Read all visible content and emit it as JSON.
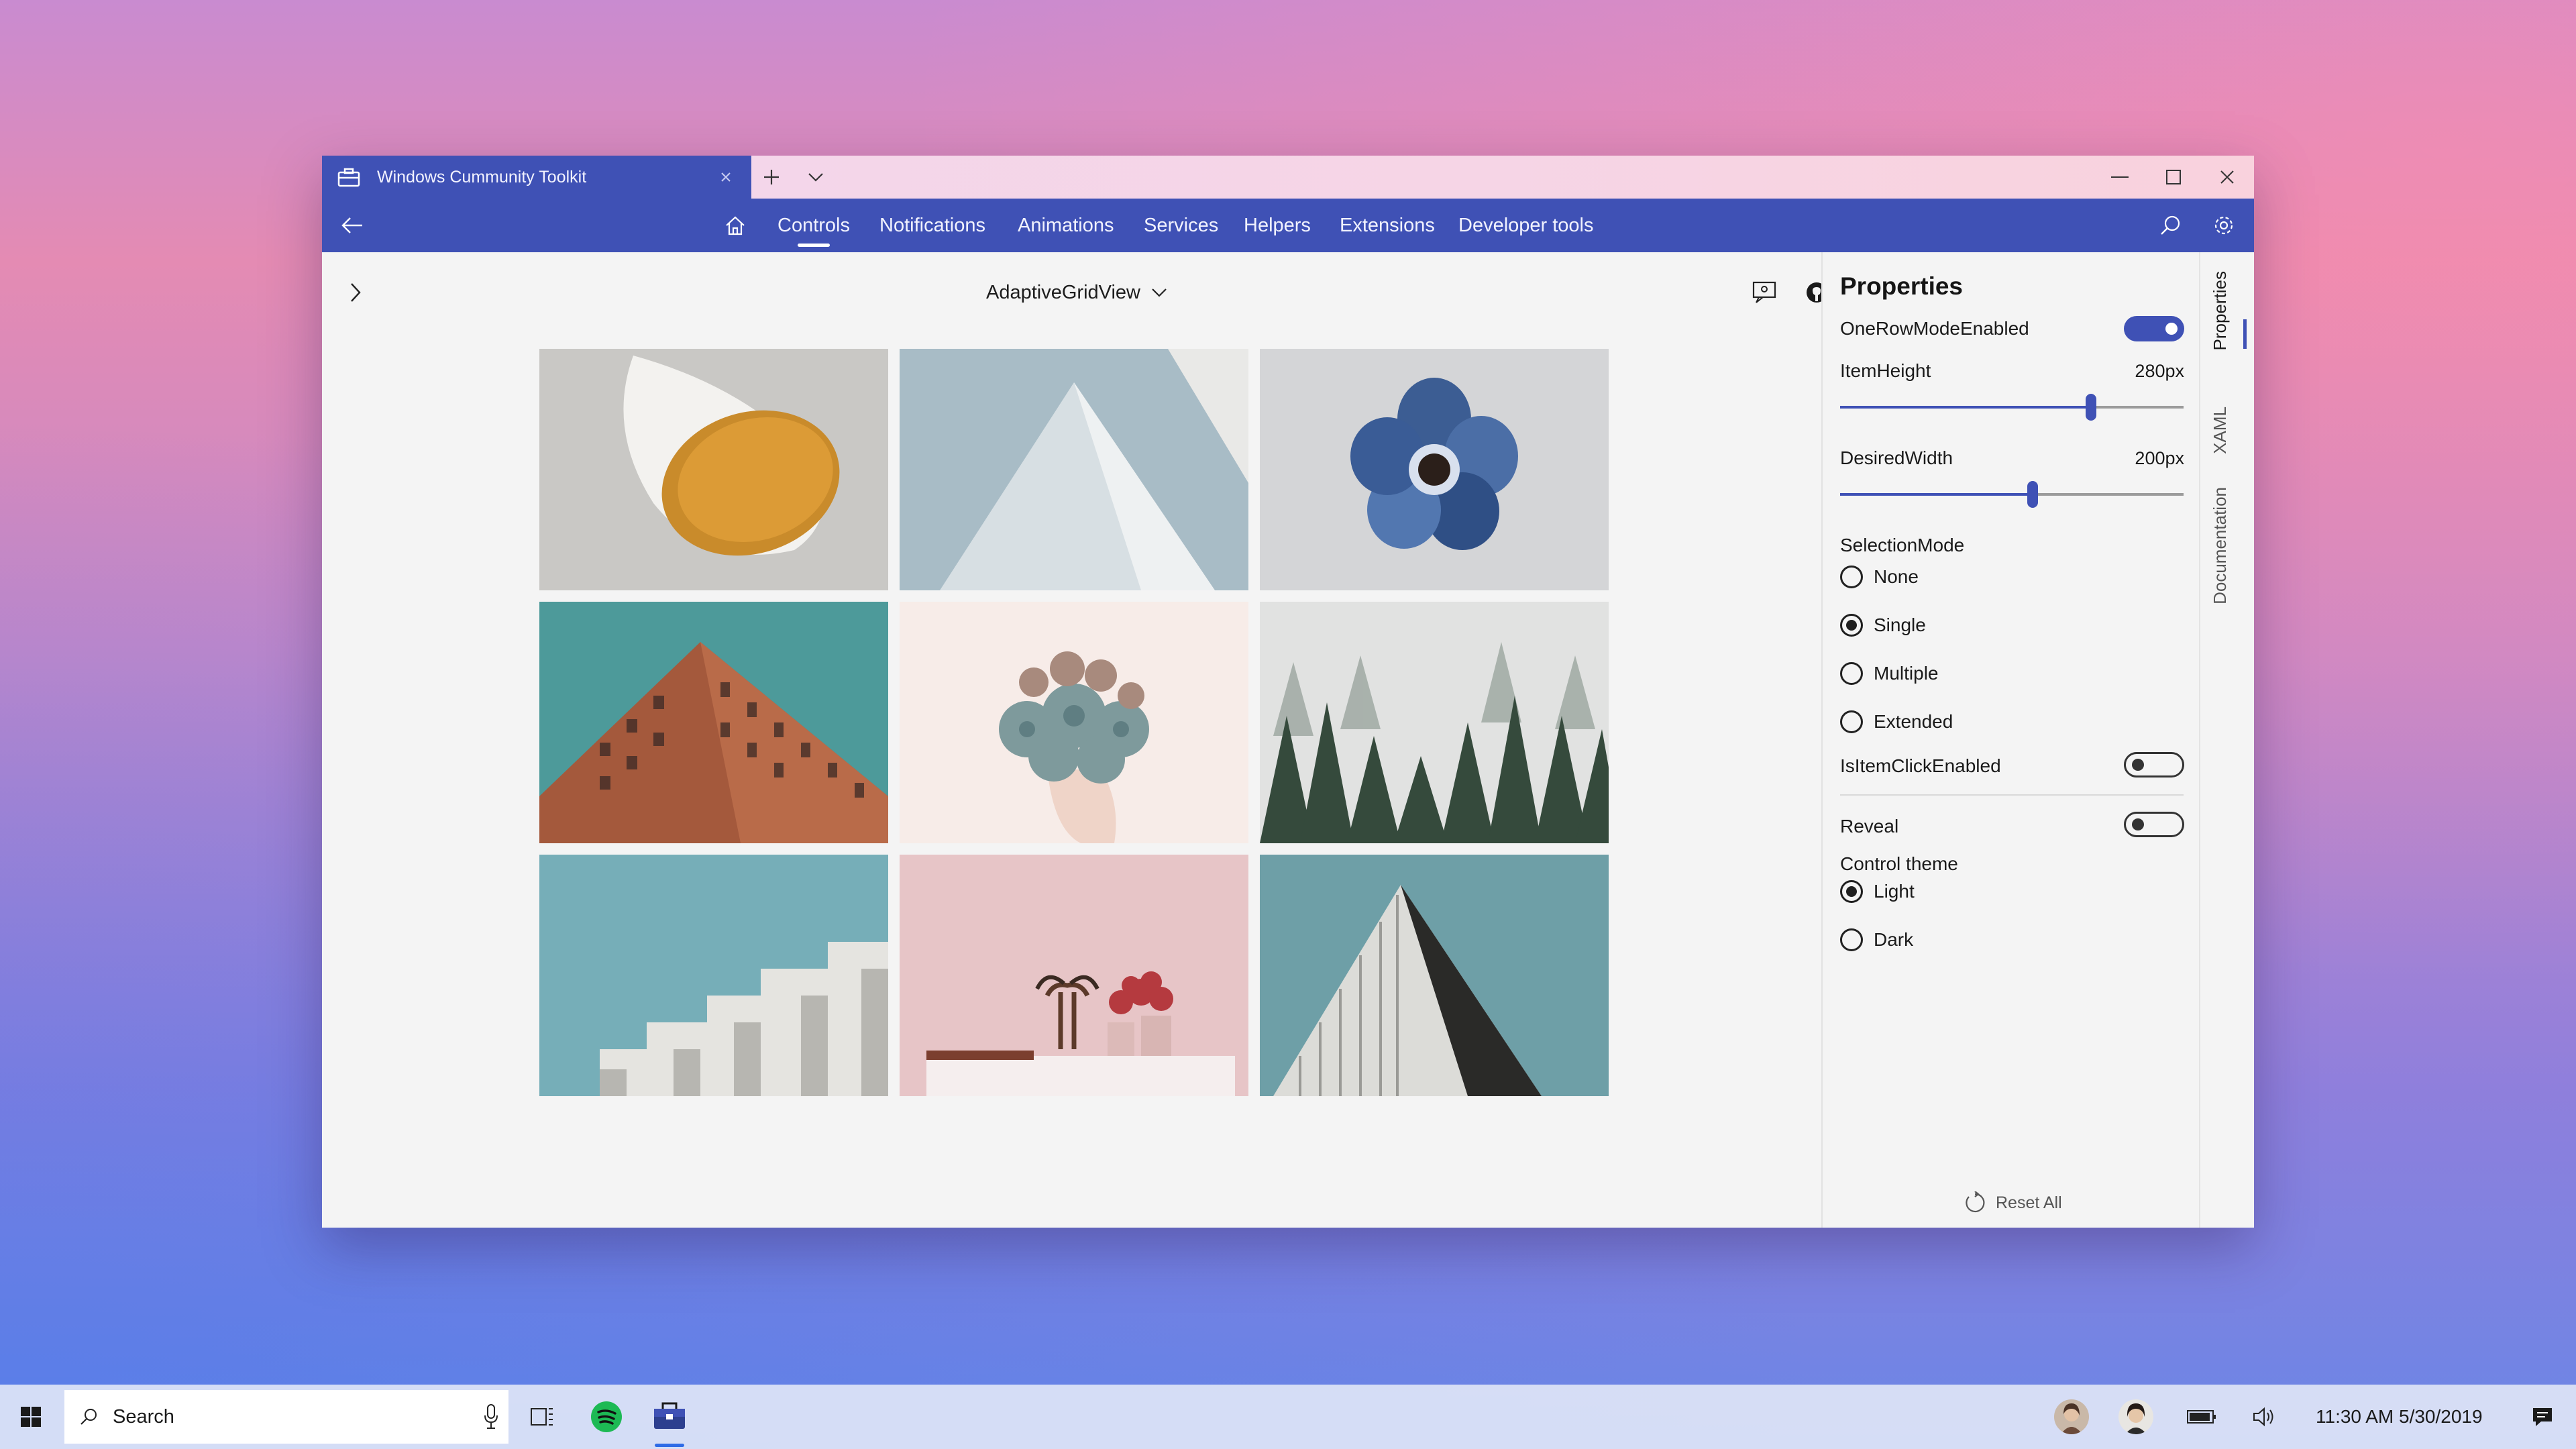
{
  "window": {
    "tab_title": "Windows Cummunity Toolkit"
  },
  "nav": {
    "items": [
      {
        "label": "Controls"
      },
      {
        "label": "Notifications"
      },
      {
        "label": "Animations"
      },
      {
        "label": "Services"
      },
      {
        "label": "Helpers"
      },
      {
        "label": "Extensions"
      },
      {
        "label": "Developer tools"
      }
    ],
    "active": "Controls"
  },
  "content": {
    "sample_picker": "AdaptiveGridView",
    "gallery": [
      "lamp-photo",
      "triangle-roof-photo",
      "blue-flower-photo",
      "building-photo",
      "succulent-bouquet-photo",
      "misty-forest-photo",
      "concrete-building-photo",
      "skull-vase-photo",
      "dark-triangle-building-photo"
    ]
  },
  "properties": {
    "title": "Properties",
    "one_row_mode_label": "OneRowModeEnabled",
    "one_row_mode_on": true,
    "item_height_label": "ItemHeight",
    "item_height_value": "280px",
    "item_height_fraction": 0.73,
    "desired_width_label": "DesiredWidth",
    "desired_width_value": "200px",
    "desired_width_fraction": 0.56,
    "selection_mode_label": "SelectionMode",
    "selection_modes": [
      "None",
      "Single",
      "Multiple",
      "Extended"
    ],
    "selection_mode_selected": "Single",
    "is_item_click_label": "IsItemClickEnabled",
    "is_item_click_on": false,
    "reveal_label": "Reveal",
    "reveal_on": false,
    "control_theme_label": "Control theme",
    "themes": [
      "Light",
      "Dark"
    ],
    "theme_selected": "Light",
    "reset_label": "Reset All"
  },
  "side_tabs": [
    "Properties",
    "XAML",
    "Documentation"
  ],
  "taskbar": {
    "search_label": "Search",
    "clock": "11:30 AM 5/30/2019"
  },
  "colors": {
    "accent": "#3f51b5",
    "spotify": "#1db954"
  }
}
